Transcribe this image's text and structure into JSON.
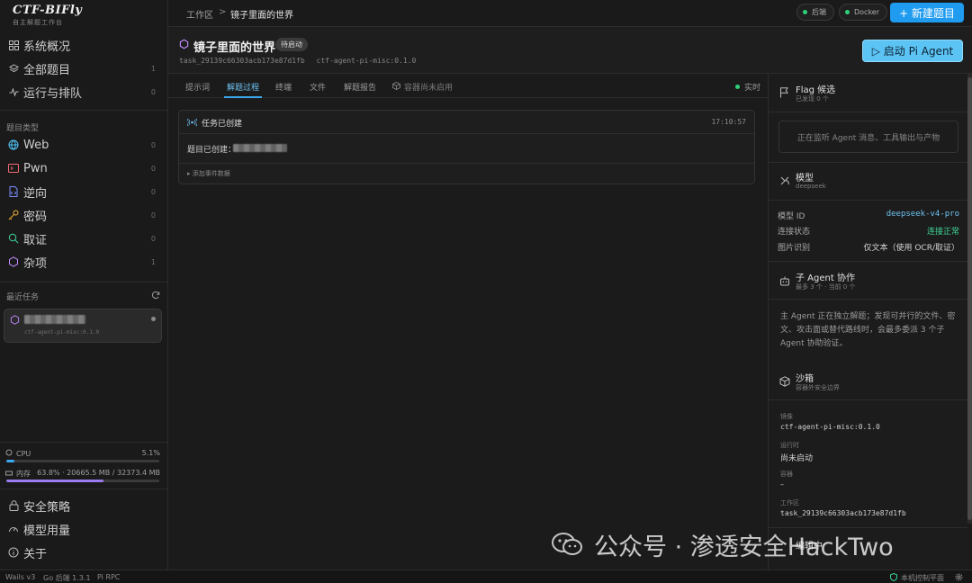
{
  "brand": {
    "name": "CTF-BIFly",
    "subtitle": "自主解题工作台"
  },
  "sidebar": {
    "main_nav": [
      {
        "label": "系统概况",
        "icon": "grid-icon",
        "count": ""
      },
      {
        "label": "全部题目",
        "icon": "layers-icon",
        "count": "1"
      },
      {
        "label": "运行与排队",
        "icon": "activity-icon",
        "count": "0"
      }
    ],
    "category_heading": "题目类型",
    "categories": [
      {
        "label": "Web",
        "icon": "globe-icon",
        "count": "0",
        "color": "#4fc3f7"
      },
      {
        "label": "Pwn",
        "icon": "terminal-icon",
        "count": "0",
        "color": "#ef6b73"
      },
      {
        "label": "逆向",
        "icon": "file-code-icon",
        "count": "0",
        "color": "#7a8cff"
      },
      {
        "label": "密码",
        "icon": "key-icon",
        "count": "0",
        "color": "#f2b233"
      },
      {
        "label": "取证",
        "icon": "search-icon",
        "count": "0",
        "color": "#3ed598"
      },
      {
        "label": "杂项",
        "icon": "hexagon-icon",
        "count": "1",
        "color": "#c58cff"
      }
    ],
    "recent_heading": "最近任务",
    "recent_tasks": [
      {
        "image": "ctf-agent-pi-misc:0.1.0"
      }
    ],
    "resources": {
      "cpu_label": "CPU",
      "cpu_value": "5.1%",
      "cpu_fraction": 0.051,
      "mem_label": "内存",
      "mem_value": "63.8% · 20665.5 MB / 32373.4 MB",
      "mem_fraction": 0.638
    },
    "bottom_nav": [
      {
        "label": "安全策略",
        "icon": "lock-icon"
      },
      {
        "label": "模型用量",
        "icon": "gauge-icon"
      },
      {
        "label": "关于",
        "icon": "info-icon"
      }
    ]
  },
  "topbar": {
    "crumb_root": "工作区",
    "crumb_sep": ">",
    "crumb_current": "镜子里面的世界",
    "status_backend": "后端",
    "status_docker": "Docker",
    "new_button": "+  新建题目"
  },
  "task": {
    "title": "镜子里面的世界",
    "status": "待启动",
    "task_id": "task_29139c66303acb173e87d1fb",
    "image": "ctf-agent-pi-misc:0.1.0",
    "launch_button": "▷ 启动 Pi Agent"
  },
  "tabs": {
    "items": [
      "提示词",
      "解题过程",
      "终端",
      "文件",
      "解题报告",
      "容器尚未启用"
    ],
    "active_index": 1,
    "live_label": "实时"
  },
  "event": {
    "title": "任务已创建",
    "time": "17:10:57",
    "body_prefix": "题目已创建：",
    "expand_label": "▸ 添加事件数据"
  },
  "right_panel": {
    "flag": {
      "title": "Flag 候选",
      "subtitle": "已发现 0 个",
      "placeholder": "正在监听 Agent 消息、工具输出与产物"
    },
    "model": {
      "title": "模型",
      "subtitle": "deepseek",
      "rows": [
        {
          "key": "模型 ID",
          "value": "deepseek-v4-pro",
          "color": "#6ec2f2"
        },
        {
          "key": "连接状态",
          "value": "连接正常",
          "color": "#3ed598"
        },
        {
          "key": "图片识别",
          "value": "仅文本（使用 OCR/取证）",
          "color": "#d4d4d4"
        }
      ]
    },
    "subagents": {
      "title": "子 Agent 协作",
      "subtitle": "最多 3 个 · 当前 0 个",
      "description": "主 Agent 正在独立解题；发现可并行的文件、密文、攻击面或替代路线时，会最多委派 3 个子 Agent 协助验证。"
    },
    "sandbox": {
      "title": "沙箱",
      "subtitle": "容器外安全边界",
      "fields": [
        {
          "label": "镜像",
          "value": "ctf-agent-pi-misc:0.1.0"
        },
        {
          "label": "运行时",
          "value": "尚未启动"
        },
        {
          "label": "容器",
          "value": "–"
        },
        {
          "label": "工作区",
          "value": "task_29139c66303acb173e87d1fb"
        }
      ],
      "next_title": "编辑中"
    }
  },
  "statusbar": {
    "items": [
      "Wails v3",
      "Go 后端 1.3.1",
      "Pi RPC"
    ],
    "right_label": "本机控制平面"
  },
  "watermark": {
    "text": "公众号 · 渗透安全HackTwo"
  }
}
